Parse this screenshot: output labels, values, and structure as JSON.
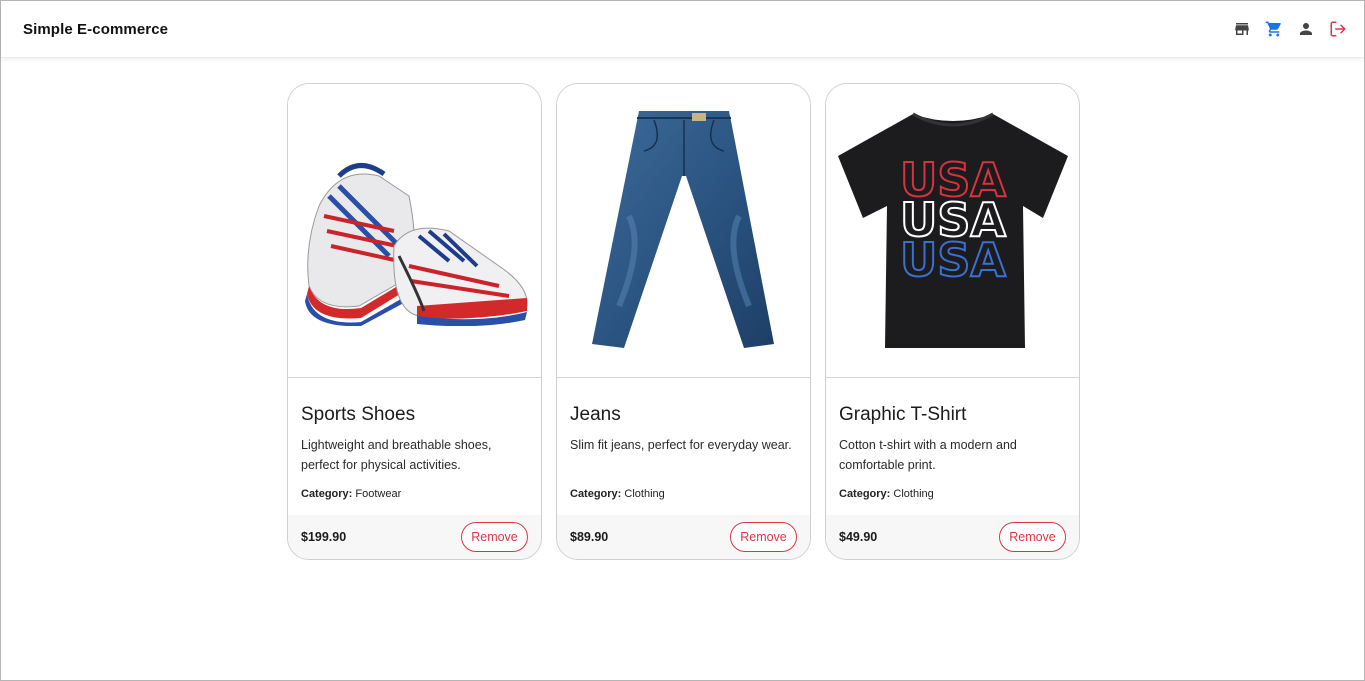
{
  "header": {
    "brand": "Simple E-commerce",
    "icons": [
      {
        "name": "store-icon",
        "color": "#444444"
      },
      {
        "name": "cart-icon",
        "color": "#1a73e8"
      },
      {
        "name": "user-icon",
        "color": "#444444"
      },
      {
        "name": "logout-icon",
        "color": "#dc3545"
      }
    ]
  },
  "products": [
    {
      "title": "Sports Shoes",
      "description": "Lightweight and breathable shoes, perfect for physical activities.",
      "category_label": "Category:",
      "category": "Footwear",
      "price": "$199.90",
      "remove_label": "Remove",
      "image_icon": "sneakers-image"
    },
    {
      "title": "Jeans",
      "description": "Slim fit jeans, perfect for everyday wear.",
      "category_label": "Category:",
      "category": "Clothing",
      "price": "$89.90",
      "remove_label": "Remove",
      "image_icon": "jeans-image"
    },
    {
      "title": "Graphic T-Shirt",
      "description": "Cotton t-shirt with a modern and comfortable print.",
      "category_label": "Category:",
      "category": "Clothing",
      "price": "$49.90",
      "remove_label": "Remove",
      "image_icon": "tshirt-image",
      "image_text": "USA"
    }
  ],
  "colors": {
    "danger": "#dc3545",
    "primary": "#1a73e8"
  }
}
